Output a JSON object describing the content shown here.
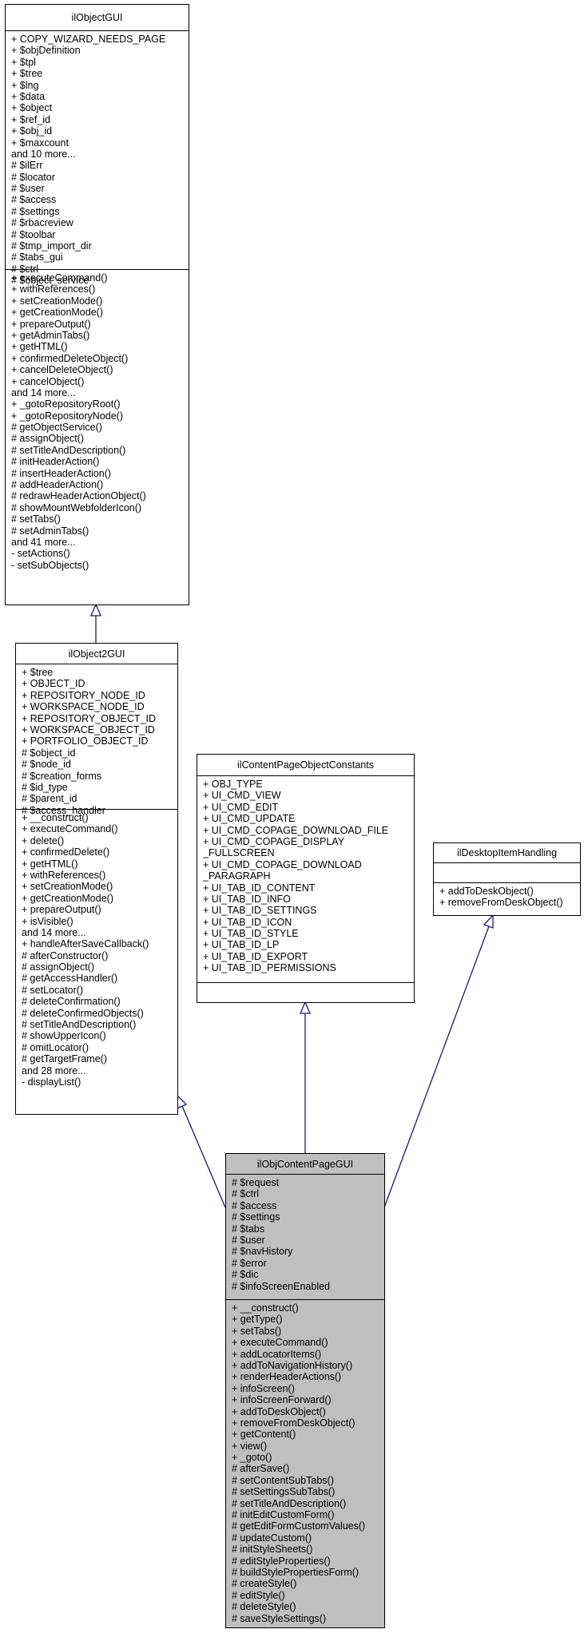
{
  "colors": {
    "edge": "#191970",
    "highlight_fill": "#bfbfbf",
    "border": "#000000"
  },
  "classes": {
    "ilObjectGUI": {
      "name": "ilObjectGUI",
      "attributes": [
        "+ COPY_WIZARD_NEEDS_PAGE",
        "+ $objDefinition",
        "+ $tpl",
        "+ $tree",
        "+ $lng",
        "+ $data",
        "+ $object",
        "+ $ref_id",
        "+ $obj_id",
        "+ $maxcount",
        "and 10 more...",
        "# $ilErr",
        "# $locator",
        "# $user",
        "# $access",
        "# $settings",
        "# $rbacreview",
        "# $toolbar",
        "# $tmp_import_dir",
        "# $tabs_gui",
        "# $ctrl",
        "# $object_service"
      ],
      "operations": [
        "+ executeCommand()",
        "+ withReferences()",
        "+ setCreationMode()",
        "+ getCreationMode()",
        "+ prepareOutput()",
        "+ getAdminTabs()",
        "+ getHTML()",
        "+ confirmedDeleteObject()",
        "+ cancelDeleteObject()",
        "+ cancelObject()",
        "and 14 more...",
        "+ _gotoRepositoryRoot()",
        "+ _gotoRepositoryNode()",
        "# getObjectService()",
        "# assignObject()",
        "# setTitleAndDescription()",
        "# initHeaderAction()",
        "# insertHeaderAction()",
        "# addHeaderAction()",
        "# redrawHeaderActionObject()",
        "# showMountWebfolderIcon()",
        "# setTabs()",
        "# setAdminTabs()",
        "and 41 more...",
        "- setActions()",
        "- setSubObjects()"
      ]
    },
    "ilObject2GUI": {
      "name": "ilObject2GUI",
      "attributes": [
        "+ $tree",
        "+ OBJECT_ID",
        "+ REPOSITORY_NODE_ID",
        "+ WORKSPACE_NODE_ID",
        "+ REPOSITORY_OBJECT_ID",
        "+ WORKSPACE_OBJECT_ID",
        "+ PORTFOLIO_OBJECT_ID",
        "# $object_id",
        "# $node_id",
        "# $creation_forms",
        "# $id_type",
        "# $parent_id",
        "# $access_handler"
      ],
      "operations": [
        "+ __construct()",
        "+ executeCommand()",
        "+ delete()",
        "+ confirmedDelete()",
        "+ getHTML()",
        "+ withReferences()",
        "+ setCreationMode()",
        "+ getCreationMode()",
        "+ prepareOutput()",
        "+ isVisible()",
        "and 14 more...",
        "+ handleAfterSaveCallback()",
        "# afterConstructor()",
        "# assignObject()",
        "# getAccessHandler()",
        "# setLocator()",
        "# deleteConfirmation()",
        "# deleteConfirmedObjects()",
        "# setTitleAndDescription()",
        "# showUpperIcon()",
        "# omitLocator()",
        "# getTargetFrame()",
        "and 28 more...",
        "- displayList()"
      ]
    },
    "ilContentPageObjectConstants": {
      "name": "ilContentPageObjectConstants",
      "attributes": [
        "+ OBJ_TYPE",
        "+ UI_CMD_VIEW",
        "+ UI_CMD_EDIT",
        "+ UI_CMD_UPDATE",
        "+ UI_CMD_COPAGE_DOWNLOAD_FILE",
        "+ UI_CMD_COPAGE_DISPLAY",
        "_FULLSCREEN",
        "+ UI_CMD_COPAGE_DOWNLOAD",
        "_PARAGRAPH",
        "+ UI_TAB_ID_CONTENT",
        "+ UI_TAB_ID_INFO",
        "+ UI_TAB_ID_SETTINGS",
        "+ UI_TAB_ID_ICON",
        "+ UI_TAB_ID_STYLE",
        "+ UI_TAB_ID_LP",
        "+ UI_TAB_ID_EXPORT",
        "+ UI_TAB_ID_PERMISSIONS"
      ],
      "operations": []
    },
    "ilDesktopItemHandling": {
      "name": "ilDesktopItemHandling",
      "attributes": [],
      "operations": [
        "+ addToDeskObject()",
        "+ removeFromDeskObject()"
      ]
    },
    "ilObjContentPageGUI": {
      "name": "ilObjContentPageGUI",
      "attributes": [
        "# $request",
        "# $ctrl",
        "# $access",
        "# $settings",
        "# $tabs",
        "# $user",
        "# $navHistory",
        "# $error",
        "# $dic",
        "# $infoScreenEnabled"
      ],
      "operations": [
        "+ __construct()",
        "+ getType()",
        "+ setTabs()",
        "+ executeCommand()",
        "+ addLocatorItems()",
        "+ addToNavigationHistory()",
        "+ renderHeaderActions()",
        "+ infoScreen()",
        "+ infoScreenForward()",
        "+ addToDeskObject()",
        "+ removeFromDeskObject()",
        "+ getContent()",
        "+ view()",
        "+ _goto()",
        "# afterSave()",
        "# setContentSubTabs()",
        "# setSettingsSubTabs()",
        "# setTitleAndDescription()",
        "# initEditCustomForm()",
        "# getEditFormCustomValues()",
        "# updateCustom()",
        "# initStyleSheets()",
        "# editStyleProperties()",
        "# buildStylePropertiesForm()",
        "# createStyle()",
        "# editStyle()",
        "# deleteStyle()",
        "# saveStyleSettings()"
      ]
    }
  },
  "relations": [
    {
      "type": "inheritance",
      "from": "ilObject2GUI",
      "to": "ilObjectGUI"
    },
    {
      "type": "inheritance",
      "from": "ilObjContentPageGUI",
      "to": "ilObject2GUI"
    },
    {
      "type": "inheritance",
      "from": "ilObjContentPageGUI",
      "to": "ilContentPageObjectConstants"
    },
    {
      "type": "inheritance",
      "from": "ilObjContentPageGUI",
      "to": "ilDesktopItemHandling"
    }
  ]
}
